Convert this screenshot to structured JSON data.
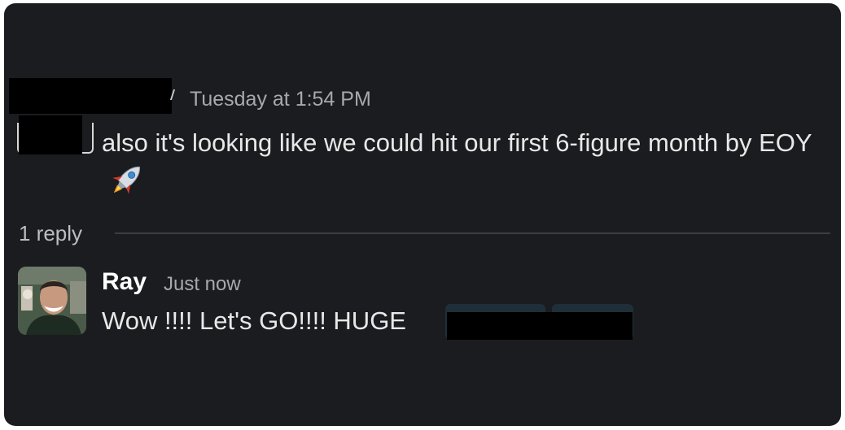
{
  "message": {
    "timestamp": "Tuesday at 1:54 PM",
    "text": "also it's looking like we could hit our first 6-figure month by EOY",
    "emoji_icon": "rocket-icon"
  },
  "thread": {
    "reply_count_label": "1 reply"
  },
  "reply": {
    "author": "Ray",
    "timestamp": "Just now",
    "text": "Wow !!!! Let's GO!!!! HUGE"
  },
  "colors": {
    "background": "#1b1c1f",
    "text": "#e8e8e8",
    "muted": "#a8a9ac",
    "mention": "#1f2f39"
  }
}
